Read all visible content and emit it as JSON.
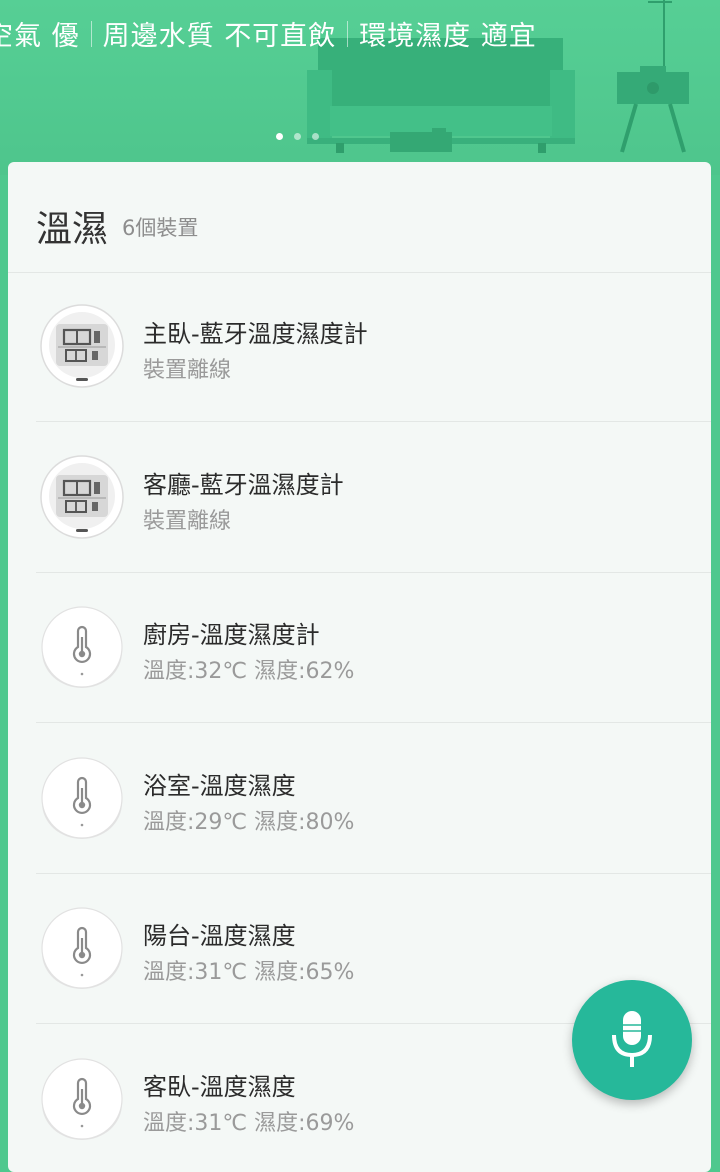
{
  "banner": {
    "ticker": [
      {
        "label": "空氣",
        "value": "優"
      },
      {
        "label": "周邊水質",
        "value": "不可直飲"
      },
      {
        "label": "環境濕度",
        "value": "適宜"
      }
    ],
    "page_count": 3,
    "active_page": 1
  },
  "card": {
    "title": "溫濕",
    "count": "6個裝置"
  },
  "devices": [
    {
      "name": "主臥-藍牙溫度濕度計",
      "status": "裝置離線",
      "icon": "lcd-hygrometer-icon"
    },
    {
      "name": "客廳-藍牙溫濕度計",
      "status": "裝置離線",
      "icon": "lcd-hygrometer-icon"
    },
    {
      "name": "廚房-溫度濕度計",
      "status": "溫度:32℃ 濕度:62%",
      "icon": "thermometer-sensor-icon"
    },
    {
      "name": "浴室-溫度濕度",
      "status": "溫度:29℃ 濕度:80%",
      "icon": "thermometer-sensor-icon"
    },
    {
      "name": "陽台-溫度濕度",
      "status": "溫度:31℃ 濕度:65%",
      "icon": "thermometer-sensor-icon"
    },
    {
      "name": "客臥-溫度濕度",
      "status": "溫度:31℃ 濕度:69%",
      "icon": "thermometer-sensor-icon"
    }
  ],
  "fab": {
    "icon": "microphone-icon"
  },
  "colors": {
    "banner": "#4fc88e",
    "fab": "#26b89a",
    "card": "#f4f8f6"
  }
}
